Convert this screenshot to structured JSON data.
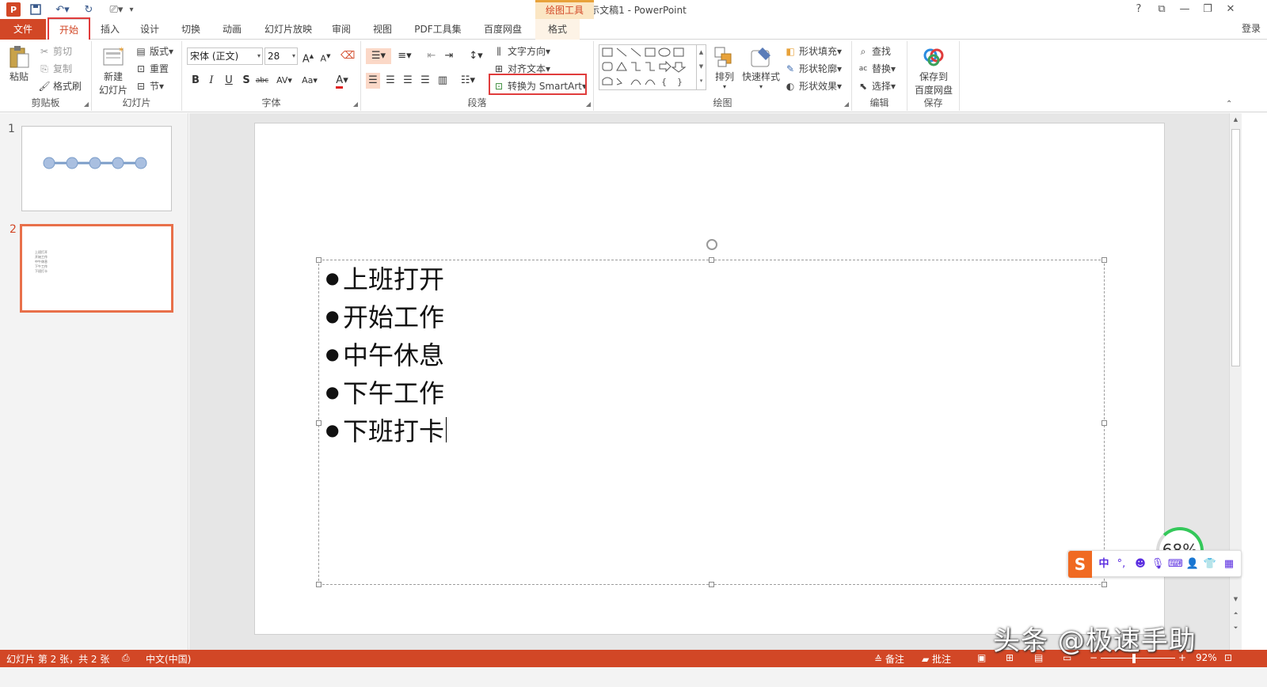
{
  "title_bar": {
    "app_icon": "P",
    "doc_title": "演示文稿1 - PowerPoint",
    "contextual_group": "绘图工具",
    "controls": [
      "?",
      "⧉",
      "—",
      "❐",
      "✕"
    ]
  },
  "tabs": {
    "file": "文件",
    "home": "开始",
    "insert": "插入",
    "design": "设计",
    "transitions": "切换",
    "animations": "动画",
    "slideshow": "幻灯片放映",
    "review": "审阅",
    "view": "视图",
    "pdf": "PDF工具集",
    "baidu": "百度网盘",
    "format": "格式",
    "login": "登录"
  },
  "ribbon": {
    "clipboard": {
      "label": "剪贴板",
      "paste": "粘贴",
      "cut": "剪切",
      "copy": "复制",
      "format_painter": "格式刷"
    },
    "slides": {
      "label": "幻灯片",
      "new_slide": "新建",
      "new_slide2": "幻灯片",
      "layout": "版式",
      "reset": "重置",
      "section": "节"
    },
    "font": {
      "label": "字体",
      "font_name": "宋体 (正文)",
      "font_size": "28"
    },
    "paragraph": {
      "label": "段落",
      "text_direction": "文字方向",
      "align_text": "对齐文本",
      "convert_smartart": "转换为 SmartArt"
    },
    "drawing": {
      "label": "绘图",
      "arrange": "排列",
      "quick_styles": "快速样式",
      "shape_fill": "形状填充",
      "shape_outline": "形状轮廓",
      "shape_effects": "形状效果"
    },
    "editing": {
      "label": "编辑",
      "find": "查找",
      "replace": "替换",
      "select": "选择"
    },
    "save": {
      "label": "保存",
      "save_to": "保存到",
      "baidu_disk": "百度网盘"
    }
  },
  "thumbnails": {
    "slide1_num": "1",
    "slide2_num": "2",
    "slide2_lines": [
      "上班打开",
      "开始工作",
      "中午休息",
      "下午工作",
      "下班打卡"
    ]
  },
  "slide": {
    "bullets": [
      "上班打开",
      "开始工作",
      "中午休息",
      "下午工作",
      "下班打卡"
    ]
  },
  "ime": {
    "logo": "S",
    "mode": "中",
    "punct": "°,",
    "speed": "68%"
  },
  "statusbar": {
    "slide_info": "幻灯片 第 2 张，共 2 张",
    "language": "中文(中国)",
    "notes": "备注",
    "comments": "批注",
    "zoom_minus": "−",
    "zoom_plus": "+",
    "zoom_level": "92%"
  },
  "watermark": "头条 @极速手助",
  "colors": {
    "accent": "#d24726",
    "highlight": "#e03c3c",
    "contextual": "#e8a23a"
  }
}
